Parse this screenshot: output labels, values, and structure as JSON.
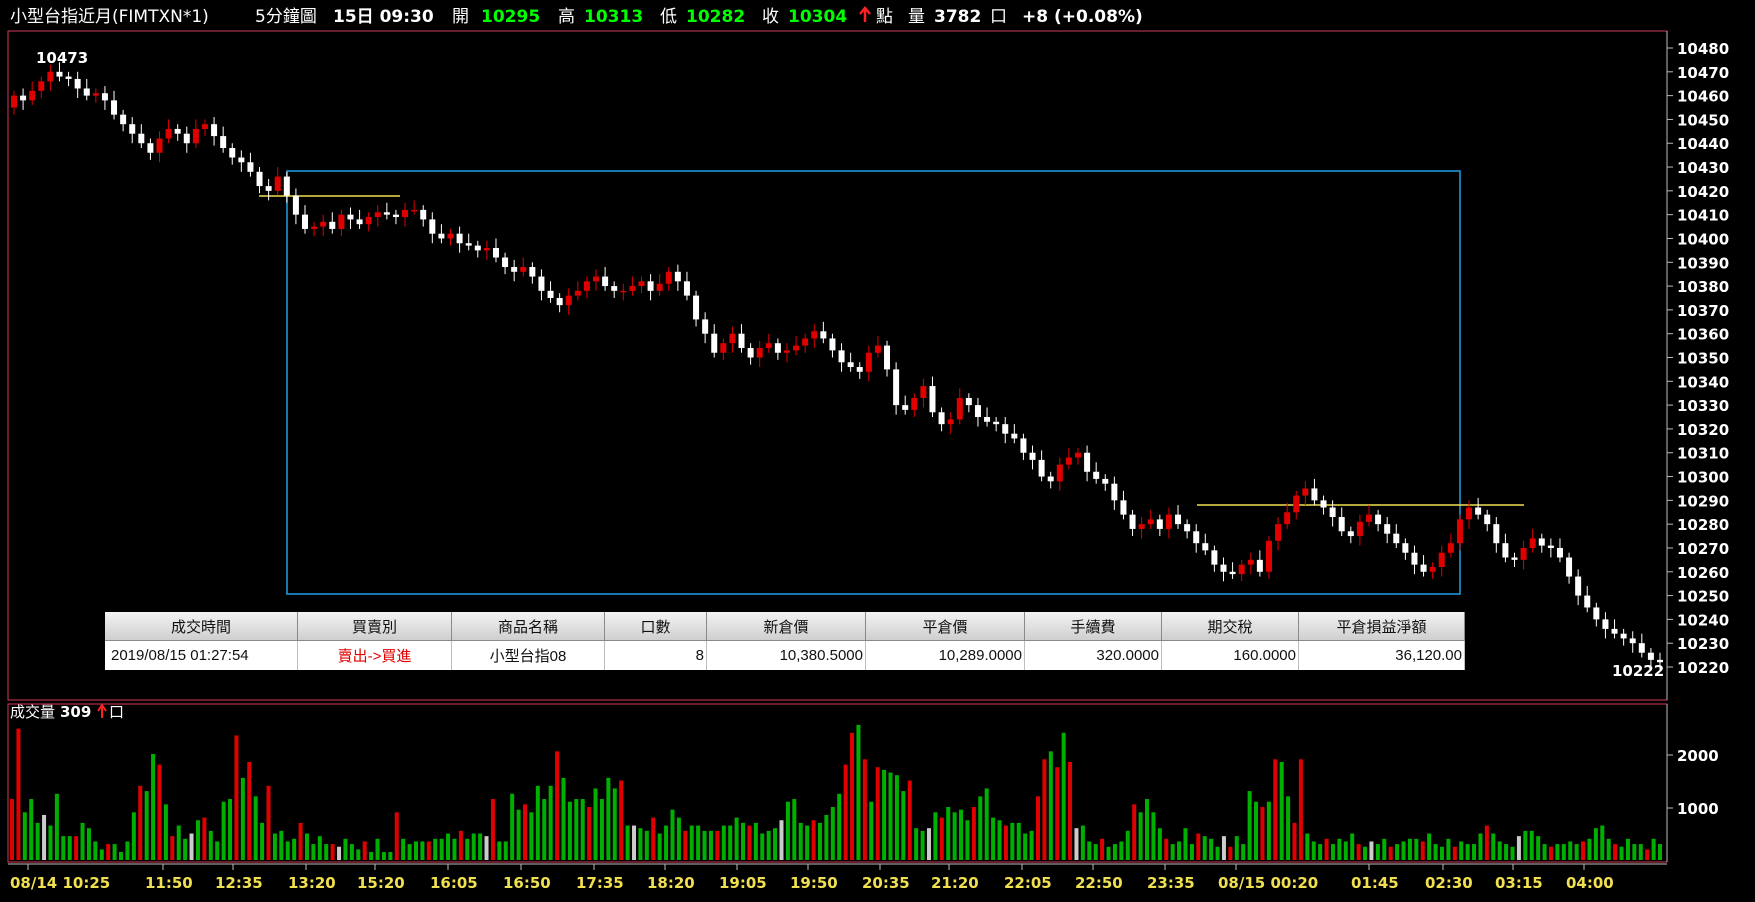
{
  "header": {
    "symbol": "小型台指近月(FIMTXN*1)",
    "period": "5分鐘圖",
    "time": "15日 09:30",
    "open_label": "開",
    "open": "10295",
    "high_label": "高",
    "high": "10313",
    "low_label": "低",
    "low": "10282",
    "close_label": "收",
    "close": "10304",
    "unit_pt": "點",
    "vol_label": "量",
    "vol": "3782",
    "vol_unit": "口",
    "change": "+8 (+0.08%)"
  },
  "volume_header": {
    "label": "成交量",
    "value": "309",
    "unit": "口"
  },
  "chart_data": {
    "type": "candlestick",
    "price_axis": {
      "min": 10220,
      "max": 10480,
      "step": 10
    },
    "volume_axis": {
      "ticks": [
        "2000",
        "1000"
      ]
    },
    "high_label": "10473",
    "last_label": "10222",
    "x_labels": [
      "08/14 10:25",
      "11:50",
      "12:35",
      "13:20",
      "15:20",
      "16:05",
      "16:50",
      "17:35",
      "18:20",
      "19:05",
      "19:50",
      "20:35",
      "21:20",
      "22:05",
      "22:50",
      "23:35",
      "08/15 00:20",
      "01:45",
      "02:30",
      "03:15",
      "04:00"
    ],
    "closes": [
      10460,
      10458,
      10462,
      10466,
      10470,
      10468,
      10467,
      10463,
      10460,
      10461,
      10458,
      10452,
      10448,
      10444,
      10440,
      10436,
      10442,
      10446,
      10444,
      10440,
      10446,
      10448,
      10443,
      10438,
      10434,
      10432,
      10428,
      10422,
      10420,
      10426,
      10418,
      10410,
      10404,
      10405,
      10407,
      10404,
      10410,
      10408,
      10406,
      10409,
      10411,
      10410,
      10409,
      10412,
      10412,
      10408,
      10402,
      10400,
      10402,
      10398,
      10397,
      10395,
      10396,
      10392,
      10388,
      10386,
      10388,
      10384,
      10378,
      10375,
      10372,
      10376,
      10378,
      10382,
      10384,
      10380,
      10378,
      10378,
      10380,
      10382,
      10378,
      10381,
      10386,
      10382,
      10376,
      10366,
      10360,
      10352,
      10356,
      10360,
      10354,
      10350,
      10354,
      10356,
      10352,
      10353,
      10355,
      10358,
      10361,
      10358,
      10353,
      10348,
      10346,
      10344,
      10352,
      10355,
      10345,
      10330,
      10328,
      10333,
      10338,
      10327,
      10322,
      10324,
      10333,
      10330,
      10325,
      10323,
      10322,
      10318,
      10316,
      10310,
      10307,
      10300,
      10298,
      10305,
      10308,
      10310,
      10302,
      10299,
      10297,
      10290,
      10284,
      10278,
      10280,
      10282,
      10278,
      10284,
      10280,
      10277,
      10272,
      10269,
      10263,
      10260,
      10259,
      10263,
      10265,
      10260,
      10273,
      10280,
      10285,
      10292,
      10295,
      10290,
      10287,
      10283,
      10277,
      10275,
      10281,
      10284,
      10280,
      10276,
      10272,
      10268,
      10263,
      10260,
      10262,
      10268,
      10272,
      10282,
      10287,
      10284,
      10280,
      10272,
      10266,
      10265,
      10270,
      10274,
      10271,
      10270,
      10266,
      10258,
      10250,
      10245,
      10240,
      10236,
      10234,
      10232,
      10230,
      10226,
      10223,
      10222
    ],
    "volumes": [
      1150,
      2480,
      900,
      1150,
      700,
      850,
      650,
      1250,
      450,
      450,
      450,
      700,
      600,
      350,
      200,
      300,
      300,
      150,
      350,
      900,
      1400,
      1300,
      2000,
      1800,
      1050,
      450,
      650,
      400,
      500,
      750,
      800,
      550,
      350,
      1100,
      1150,
      2350,
      1550,
      1850,
      1200,
      700,
      1400,
      500,
      550,
      350,
      400,
      700,
      500,
      300,
      450,
      300,
      300,
      250,
      400,
      300,
      200,
      350,
      150,
      400,
      150,
      150,
      900,
      400,
      300,
      350,
      350,
      350,
      400,
      400,
      500,
      400,
      550,
      400,
      500,
      500,
      450,
      1150,
      350,
      350,
      1250,
      950,
      1050,
      900,
      1400,
      1150,
      1400,
      2050,
      1550,
      1100,
      1150,
      1150,
      1000,
      1350,
      1150,
      1550,
      1350,
      1500,
      650,
      650,
      600,
      550,
      800,
      500,
      650,
      950,
      800,
      550,
      650,
      650,
      550,
      550,
      550,
      650,
      650,
      800,
      700,
      650,
      700,
      500,
      550,
      600,
      750,
      1100,
      1150,
      700,
      650,
      750,
      700,
      850,
      1000,
      1250,
      1800,
      2400,
      2550,
      1900,
      1100,
      1750,
      1700,
      1650,
      1600,
      1300,
      1500,
      600,
      550,
      600,
      900,
      800,
      1000,
      900,
      950,
      750,
      1000,
      1200,
      1350,
      800,
      750,
      650,
      700,
      700,
      500,
      550,
      1200,
      1900,
      2050,
      1750,
      2400,
      1850,
      600,
      650,
      350,
      300,
      400,
      250,
      300,
      350,
      550,
      1050,
      900,
      1150,
      900,
      600,
      400,
      300,
      350,
      600,
      300,
      500,
      450,
      400,
      250,
      450,
      250,
      450,
      300,
      1300,
      1100,
      1000,
      1100,
      1900,
      1850,
      1200,
      700,
      1900,
      500,
      350,
      300,
      400,
      300,
      400,
      350,
      500,
      300,
      250,
      350,
      300,
      400,
      250,
      300,
      350,
      400,
      400,
      350,
      500,
      300,
      250,
      400,
      250,
      350,
      300,
      300,
      500,
      650,
      500,
      350,
      300,
      250,
      450,
      550,
      550,
      450,
      300,
      250,
      300,
      300,
      350,
      300,
      350,
      400,
      600,
      650,
      400,
      300,
      250,
      400,
      300,
      300,
      200,
      400,
      300
    ]
  },
  "trade_table": {
    "headers": [
      "成交時間",
      "買賣別",
      "商品名稱",
      "口數",
      "新倉價",
      "平倉價",
      "手續費",
      "期交稅",
      "平倉損益淨額"
    ],
    "row": [
      "2019/08/15 01:27:54",
      "賣出->買進",
      "小型台指08",
      "8",
      "10,380.5000",
      "10,289.0000",
      "320.0000",
      "160.0000",
      "36,120.00"
    ]
  },
  "colors": {
    "up": "#e00000",
    "down": "#ffffff",
    "vol_up": "#e00000",
    "vol_down": "#00b000",
    "box": "#1ea0e6",
    "level_line": "#f0e050",
    "frame": "#d23a5a",
    "label_green": "#00ff00"
  }
}
